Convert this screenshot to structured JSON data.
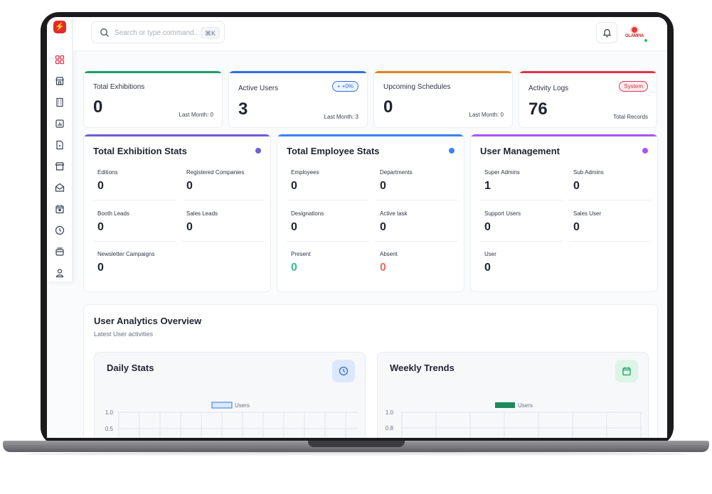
{
  "search": {
    "placeholder": "Search or type command...",
    "shortcut": "⌘K"
  },
  "header": {
    "avatar_brand": "OLAMPIA"
  },
  "sidebar": {
    "items": [
      {
        "icon": "dashboard-icon",
        "active": true
      },
      {
        "icon": "store-icon"
      },
      {
        "icon": "building-icon"
      },
      {
        "icon": "chart-icon"
      },
      {
        "icon": "document-icon"
      },
      {
        "icon": "shop-icon"
      },
      {
        "icon": "mail-icon"
      },
      {
        "icon": "calendar-icon"
      },
      {
        "icon": "clock-icon"
      },
      {
        "icon": "archive-icon"
      },
      {
        "icon": "user-icon"
      }
    ]
  },
  "stats": [
    {
      "label": "Total Exhibitions",
      "value": "0",
      "sub": "Last Month: 0",
      "color": "#1f9d6a"
    },
    {
      "label": "Active Users",
      "value": "3",
      "sub": "Last Month: 3",
      "badge": "+ +0%",
      "color": "#2f6fe0"
    },
    {
      "label": "Upcoming Schedules",
      "value": "0",
      "sub": "Last Month: 0",
      "color": "#e0861f"
    },
    {
      "label": "Activity Logs",
      "value": "76",
      "sub": "Total Records",
      "badge": "System",
      "color": "#e0344a"
    }
  ],
  "panels": {
    "exhibition": {
      "title": "Total Exhibition Stats",
      "dot_color": "#6b5fd8",
      "cells": [
        {
          "label": "Editions",
          "value": "0"
        },
        {
          "label": "Registered Companies",
          "value": "0"
        },
        {
          "label": "Booth Leads",
          "value": "0"
        },
        {
          "label": "Sales Leads",
          "value": "0"
        },
        {
          "label": "Newsletter Campaigns",
          "value": "0"
        }
      ]
    },
    "employee": {
      "title": "Total Employee Stats",
      "dot_color": "#3b82f6",
      "cells": [
        {
          "label": "Employees",
          "value": "0"
        },
        {
          "label": "Departments",
          "value": "0"
        },
        {
          "label": "Designations",
          "value": "0"
        },
        {
          "label": "Active task",
          "value": "0"
        },
        {
          "label": "Present",
          "value": "0",
          "color": "#34c28a"
        },
        {
          "label": "Absent",
          "value": "0",
          "color": "#ef6b5b"
        }
      ]
    },
    "users": {
      "title": "User Management",
      "dot_color": "#a855f7",
      "cells": [
        {
          "label": "Super Admins",
          "value": "1"
        },
        {
          "label": "Sub Admins",
          "value": "0"
        },
        {
          "label": "Support Users",
          "value": "0"
        },
        {
          "label": "Sales User",
          "value": "0"
        },
        {
          "label": "User",
          "value": "0"
        }
      ]
    }
  },
  "analytics": {
    "title": "User Analytics Overview",
    "subtitle": "Latest User activities",
    "daily": {
      "title": "Daily Stats",
      "legend": "Users",
      "ticks": [
        "1.0",
        "0.5"
      ]
    },
    "weekly": {
      "title": "Weekly Trends",
      "legend": "Users",
      "ticks": [
        "1.0",
        "0.8"
      ]
    }
  }
}
